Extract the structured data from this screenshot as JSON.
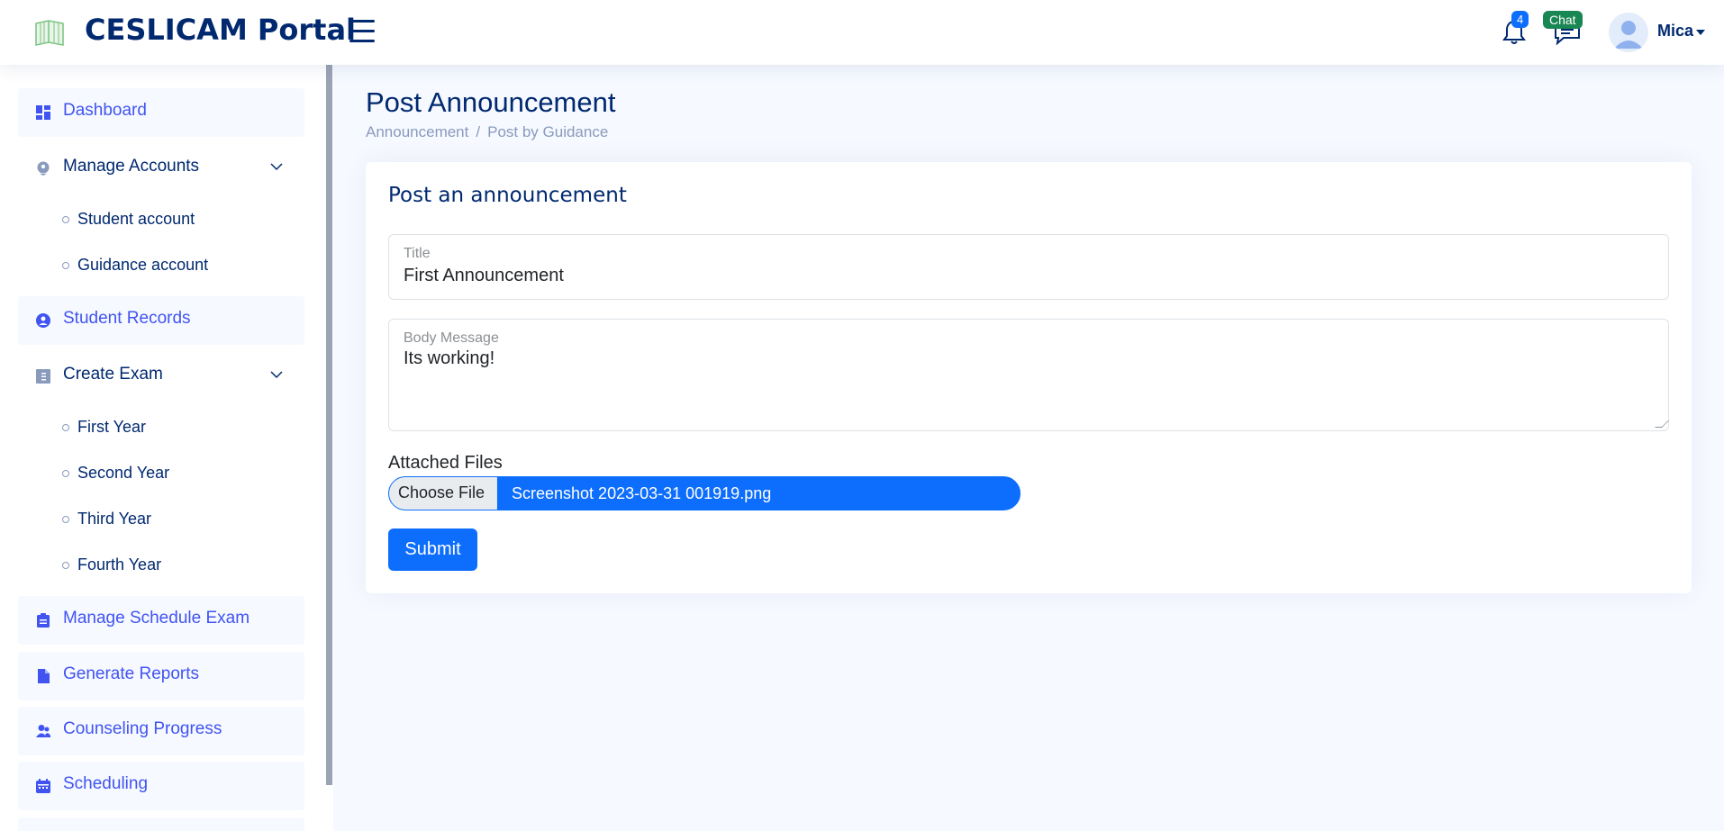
{
  "header": {
    "app_title": "CESLICAM Portal",
    "notifications_count": "4",
    "chat_label": "Chat",
    "user_name": "Mica"
  },
  "sidebar": {
    "items": [
      {
        "label": "Dashboard",
        "icon": "grid-icon"
      },
      {
        "label": "Manage Accounts",
        "icon": "map-pin-icon"
      },
      {
        "label": "Student account"
      },
      {
        "label": "Guidance account"
      },
      {
        "label": "Student Records",
        "icon": "person-circle-icon"
      },
      {
        "label": "Create Exam",
        "icon": "layout-text-icon"
      },
      {
        "label": "First Year"
      },
      {
        "label": "Second Year"
      },
      {
        "label": "Third Year"
      },
      {
        "label": "Fourth Year"
      },
      {
        "label": "Manage Schedule Exam",
        "icon": "clipboard-icon"
      },
      {
        "label": "Generate Reports",
        "icon": "file-icon"
      },
      {
        "label": "Counseling Progress",
        "icon": "people-icon"
      },
      {
        "label": "Scheduling",
        "icon": "calendar-icon"
      }
    ]
  },
  "page": {
    "title": "Post Announcement",
    "breadcrumb": [
      "Announcement",
      "Post by Guidance"
    ]
  },
  "form": {
    "card_title": "Post an announcement",
    "title_label": "Title",
    "title_value": "First Announcement",
    "body_label": "Body Message",
    "body_value": "Its working!",
    "attach_label": "Attached Files",
    "choose_file_label": "Choose File",
    "file_name": "Screenshot 2023-03-31 001919.png",
    "submit_label": "Submit"
  },
  "colors": {
    "primary": "#0d6efd",
    "nav_active": "#4154f1",
    "heading": "#012970",
    "chat_badge": "#198754",
    "background": "#f6f9ff"
  }
}
